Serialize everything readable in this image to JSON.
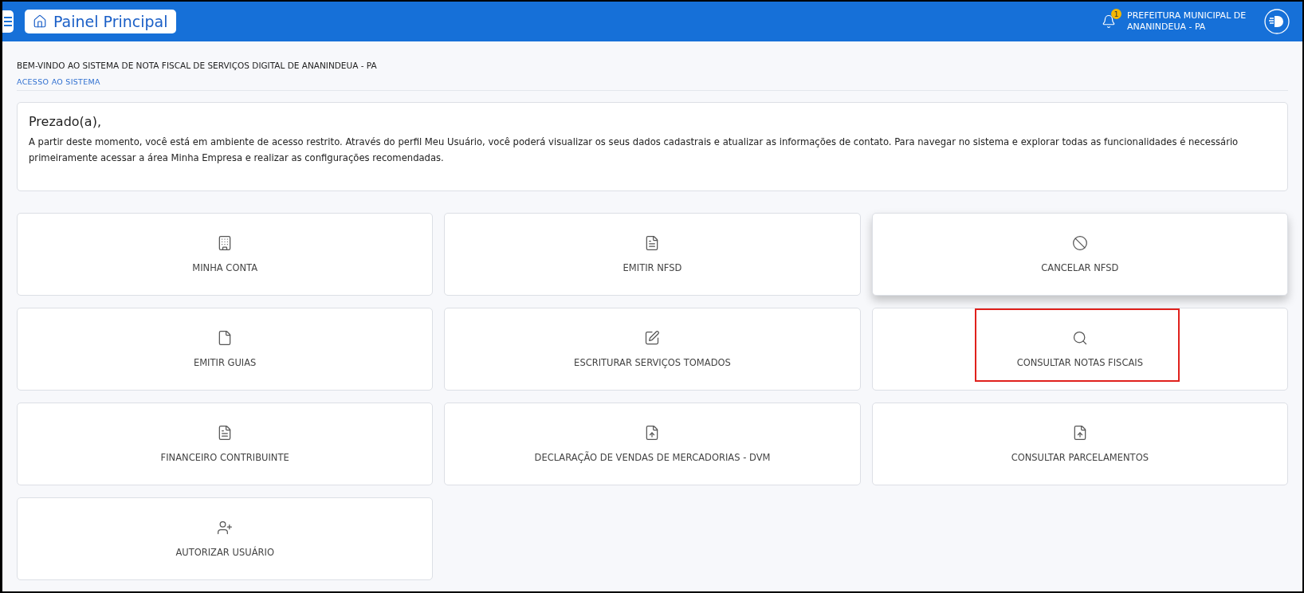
{
  "header": {
    "title": "Painel Principal",
    "notifications": "1",
    "organization": "PREFEITURA MUNICIPAL DE ANANINDEUA - PA"
  },
  "welcome": {
    "title": "BEM-VINDO AO SISTEMA DE NOTA FISCAL DE SERVIÇOS DIGITAL DE ANANINDEUA - PA",
    "subtitle": "ACESSO AO SISTEMA"
  },
  "message": {
    "greeting": "Prezado(a),",
    "body": "A partir deste momento, você está em ambiente de acesso restrito. Através do perfil Meu Usuário, você poderá visualizar os seus dados cadastrais e atualizar as informações de contato. Para navegar no sistema e explorar todas as funcionalidades é necessário primeiramente acessar a área Minha Empresa e realizar as configurações recomendadas."
  },
  "tiles": [
    {
      "label": "MINHA CONTA",
      "kind": "building",
      "hovered": false,
      "marked": false
    },
    {
      "label": "EMITIR NFSD",
      "kind": "document",
      "hovered": false,
      "marked": false
    },
    {
      "label": "CANCELAR NFSD",
      "kind": "cancel",
      "hovered": true,
      "marked": false
    },
    {
      "label": "EMITIR GUIAS",
      "kind": "page",
      "hovered": false,
      "marked": false
    },
    {
      "label": "ESCRITURAR SERVIÇOS TOMADOS",
      "kind": "edit",
      "hovered": false,
      "marked": false
    },
    {
      "label": "CONSULTAR NOTAS FISCAIS",
      "kind": "search",
      "hovered": false,
      "marked": true
    },
    {
      "label": "FINANCEIRO CONTRIBUINTE",
      "kind": "finance",
      "hovered": false,
      "marked": false
    },
    {
      "label": "DECLARAÇÃO DE VENDAS DE MERCADORIAS - DVM",
      "kind": "upload",
      "hovered": false,
      "marked": false
    },
    {
      "label": "CONSULTAR PARCELAMENTOS",
      "kind": "upload",
      "hovered": false,
      "marked": false
    },
    {
      "label": "AUTORIZAR USUÁRIO",
      "kind": "user",
      "hovered": false,
      "marked": false
    }
  ]
}
